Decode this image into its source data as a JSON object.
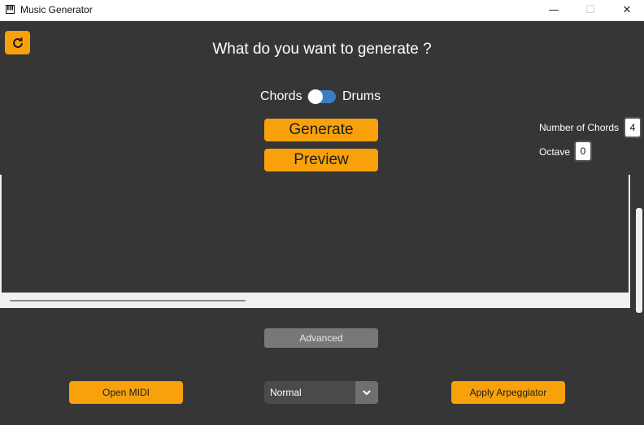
{
  "window": {
    "title": "Music Generator",
    "minimize_symbol": "—",
    "maximize_symbol": "☐",
    "close_symbol": "✕"
  },
  "colors": {
    "accent": "#f8a10b",
    "background": "#363636",
    "toggle_on": "#3a7dc4"
  },
  "main": {
    "heading": "What do you want to generate ?",
    "toggle": {
      "left_label": "Chords",
      "right_label": "Drums",
      "state": "right"
    },
    "generate_label": "Generate",
    "preview_label": "Preview",
    "params": {
      "num_chords_label": "Number of Chords",
      "num_chords_value": "4",
      "octave_label": "Octave",
      "octave_value": "0"
    },
    "advanced_label": "Advanced",
    "open_midi_label": "Open MIDI",
    "mode_dropdown_value": "Normal",
    "apply_arpeggiator_label": "Apply Arpeggiator"
  },
  "icons": {
    "refresh": "refresh-icon",
    "app": "piano-icon",
    "dropdown": "chevron-down-icon"
  }
}
